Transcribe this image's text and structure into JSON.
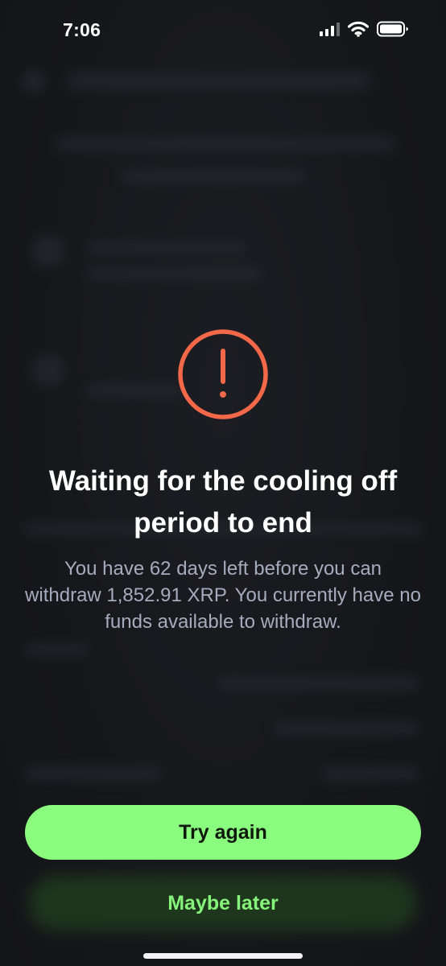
{
  "status_bar": {
    "time": "7:06",
    "icons": [
      "cellular-signal-icon",
      "wifi-icon",
      "battery-icon"
    ]
  },
  "alert": {
    "icon": "exclamation-circle-icon",
    "icon_color": "#f26849",
    "title": "Waiting for the cooling off period to end",
    "description": "You have 62 days left before you can withdraw 1,852.91 XRP. You currently have no funds available to withdraw."
  },
  "actions": {
    "primary_label": "Try again",
    "secondary_label": "Maybe later",
    "accent_color": "#8afc7e"
  }
}
